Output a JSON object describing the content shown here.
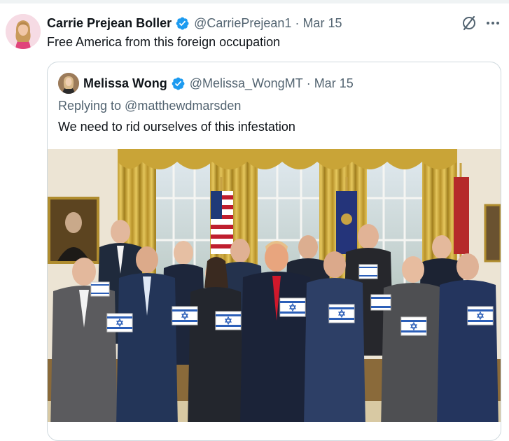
{
  "tweet": {
    "author_name": "Carrie Prejean Boller",
    "author_handle": "@CarriePrejean1",
    "separator": "·",
    "date": "Mar 15",
    "text": "Free America from this foreign occupation"
  },
  "quoted_tweet": {
    "author_name": "Melissa Wong",
    "author_handle": "@Melissa_WongMT",
    "separator": "·",
    "date": "Mar 15",
    "replying_to": "Replying to @matthewdmarsden",
    "text": "We need to rid ourselves of this infestation"
  },
  "colors": {
    "verified_blue": "#1d9bf0",
    "text_primary": "#0f1419",
    "text_secondary": "#536471",
    "border": "#cfd9de"
  },
  "icons": [
    "verified-badge-icon",
    "grok-icon",
    "more-options-icon"
  ]
}
